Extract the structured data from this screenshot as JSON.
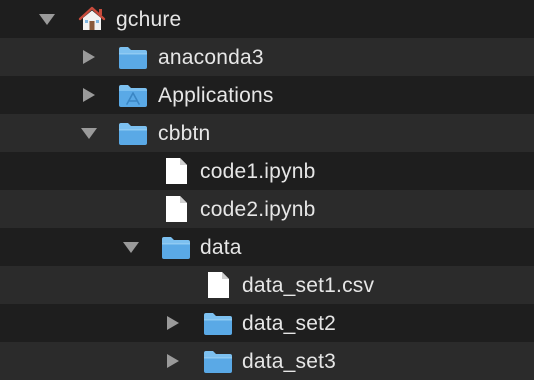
{
  "colors": {
    "row_dark": "#1e1e1e",
    "row_light": "#2b2b2b",
    "text": "#e6e6e6",
    "disclosure": "#9a9a9a",
    "folder_body": "#5aa9e6",
    "folder_tab": "#7cc0f0"
  },
  "tree": {
    "items": [
      {
        "label": "gchure",
        "icon": "home-folder-icon",
        "state": "expanded"
      },
      {
        "label": "anaconda3",
        "icon": "folder-icon",
        "state": "collapsed"
      },
      {
        "label": "Applications",
        "icon": "applications-folder-icon",
        "state": "collapsed"
      },
      {
        "label": "cbbtn",
        "icon": "folder-icon",
        "state": "expanded"
      },
      {
        "label": "code1.ipynb",
        "icon": "document-icon",
        "state": "none"
      },
      {
        "label": "code2.ipynb",
        "icon": "document-icon",
        "state": "none"
      },
      {
        "label": "data",
        "icon": "folder-icon",
        "state": "expanded"
      },
      {
        "label": "data_set1.csv",
        "icon": "document-icon",
        "state": "none"
      },
      {
        "label": "data_set2",
        "icon": "folder-icon",
        "state": "collapsed"
      },
      {
        "label": "data_set3",
        "icon": "folder-icon",
        "state": "collapsed"
      }
    ]
  }
}
